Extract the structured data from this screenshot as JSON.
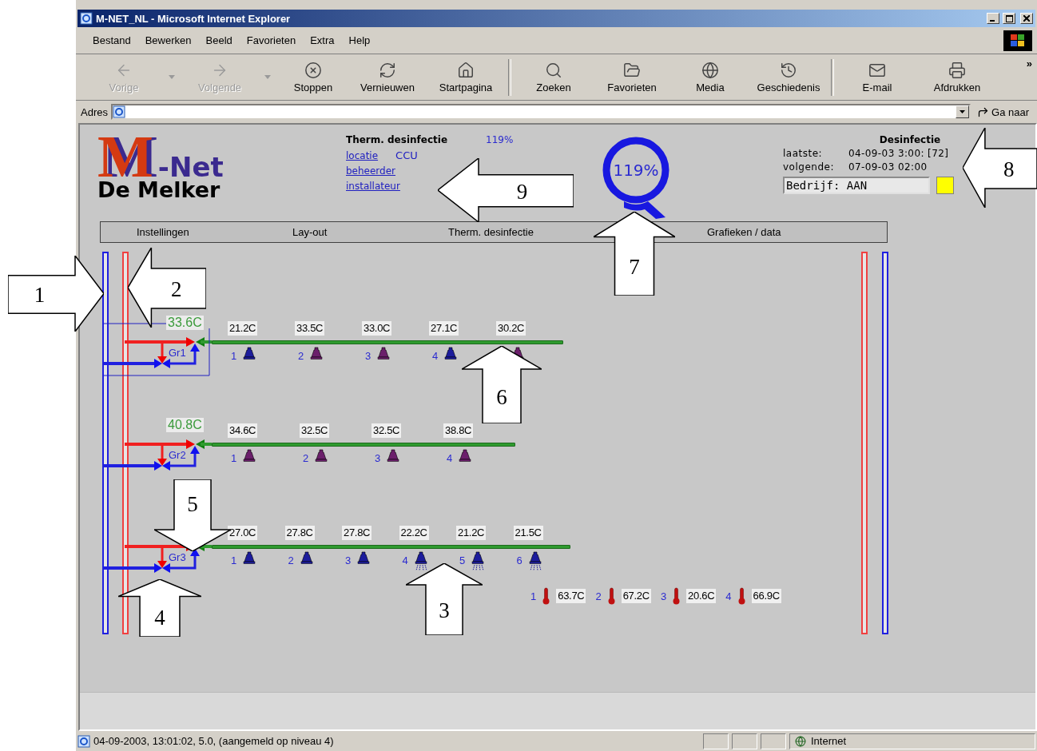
{
  "window": {
    "title": "M-NET_NL - Microsoft Internet Explorer"
  },
  "menu": [
    "Bestand",
    "Bewerken",
    "Beeld",
    "Favorieten",
    "Extra",
    "Help"
  ],
  "toolbar": [
    {
      "kind": "back",
      "label": "Vorige",
      "disabled": true
    },
    {
      "kind": "forward",
      "label": "Volgende",
      "disabled": true
    },
    {
      "kind": "stop",
      "label": "Stoppen",
      "disabled": false
    },
    {
      "kind": "refresh",
      "label": "Vernieuwen",
      "disabled": false
    },
    {
      "kind": "home",
      "label": "Startpagina",
      "disabled": false
    },
    {
      "kind": "search",
      "label": "Zoeken",
      "disabled": false
    },
    {
      "kind": "favorites",
      "label": "Favorieten",
      "disabled": false
    },
    {
      "kind": "media",
      "label": "Media",
      "disabled": false
    },
    {
      "kind": "history",
      "label": "Geschiedenis",
      "disabled": false
    },
    {
      "kind": "mail",
      "label": "E-mail",
      "disabled": false
    },
    {
      "kind": "print",
      "label": "Afdrukken",
      "disabled": false
    }
  ],
  "toolbar_more": "»",
  "address": {
    "label": "Adres",
    "go": "Ga naar"
  },
  "page": {
    "logo": {
      "mark": "M",
      "name": "-Net",
      "subtitle": "De Melker"
    },
    "program": {
      "title": "Therm. desinfectie",
      "percent": "119%",
      "links": [
        {
          "text": "locatie",
          "note": "CCU"
        },
        {
          "text": "beheerder"
        },
        {
          "text": "installateur"
        }
      ]
    },
    "gauge": {
      "value": "119%"
    },
    "disinfection": {
      "title": "Desinfectie",
      "rows": [
        {
          "label": "laatste:",
          "value": "04-09-03 3:00: [72]"
        },
        {
          "label": "volgende:",
          "value": "07-09-03 02:00"
        }
      ],
      "mode": "Bedrijf: AAN",
      "lamp_on": true
    },
    "nav": [
      "Instellingen",
      "Lay-out",
      "Therm. desinfectie",
      "Grafieken / data"
    ],
    "groups": [
      {
        "label": "Gr1",
        "setpoint": "33.6C",
        "selected": true,
        "taps": [
          {
            "number": "1",
            "temperature": "21.2C",
            "color": "#1c1c9c",
            "flowing": false
          },
          {
            "number": "2",
            "temperature": "33.5C",
            "color": "#6b1f6b",
            "flowing": false
          },
          {
            "number": "3",
            "temperature": "33.0C",
            "color": "#6b1f6b",
            "flowing": false
          },
          {
            "number": "4",
            "temperature": "27.1C",
            "color": "#1c1c9c",
            "flowing": false
          },
          {
            "temperature": "30.2C",
            "color": "#6b1f6b",
            "flowing": false
          }
        ]
      },
      {
        "label": "Gr2",
        "setpoint": "40.8C",
        "selected": false,
        "taps": [
          {
            "number": "1",
            "temperature": "34.6C",
            "color": "#6b1f6b",
            "flowing": false
          },
          {
            "number": "2",
            "temperature": "32.5C",
            "color": "#6b1f6b",
            "flowing": false
          },
          {
            "number": "3",
            "temperature": "32.5C",
            "color": "#6b1f6b",
            "flowing": false
          },
          {
            "number": "4",
            "temperature": "38.8C",
            "color": "#6b1f6b",
            "flowing": false
          }
        ]
      },
      {
        "label": "Gr3",
        "selected": false,
        "taps": [
          {
            "number": "1",
            "temperature": "27.0C",
            "color": "#1c1c9c",
            "flowing": false
          },
          {
            "number": "2",
            "temperature": "27.8C",
            "color": "#1c1c9c",
            "flowing": false
          },
          {
            "number": "3",
            "temperature": "27.8C",
            "color": "#1c1c9c",
            "flowing": false
          },
          {
            "number": "4",
            "temperature": "22.2C",
            "color": "#1c1c9c",
            "flowing": true
          },
          {
            "number": "5",
            "temperature": "21.2C",
            "color": "#1c1c9c",
            "flowing": true
          },
          {
            "number": "6",
            "temperature": "21.5C",
            "color": "#1c1c9c",
            "flowing": true
          }
        ]
      }
    ],
    "thermometers": [
      {
        "number": "1",
        "value": "63.7C"
      },
      {
        "number": "2",
        "value": "67.2C"
      },
      {
        "number": "3",
        "value": "20.6C"
      },
      {
        "number": "4",
        "value": "66.9C"
      }
    ]
  },
  "status_bar": {
    "text": "04-09-2003, 13:01:02, 5.0, (aangemeld op niveau 4)",
    "zone": "Internet"
  },
  "callouts": [
    {
      "number": "1",
      "kind": "right"
    },
    {
      "number": "2",
      "kind": "left"
    },
    {
      "number": "3",
      "kind": "up"
    },
    {
      "number": "4",
      "kind": "up"
    },
    {
      "number": "5",
      "kind": "down"
    },
    {
      "number": "6",
      "kind": "up"
    },
    {
      "number": "7",
      "kind": "up"
    },
    {
      "number": "8",
      "kind": "left"
    },
    {
      "number": "9",
      "kind": "left"
    }
  ]
}
